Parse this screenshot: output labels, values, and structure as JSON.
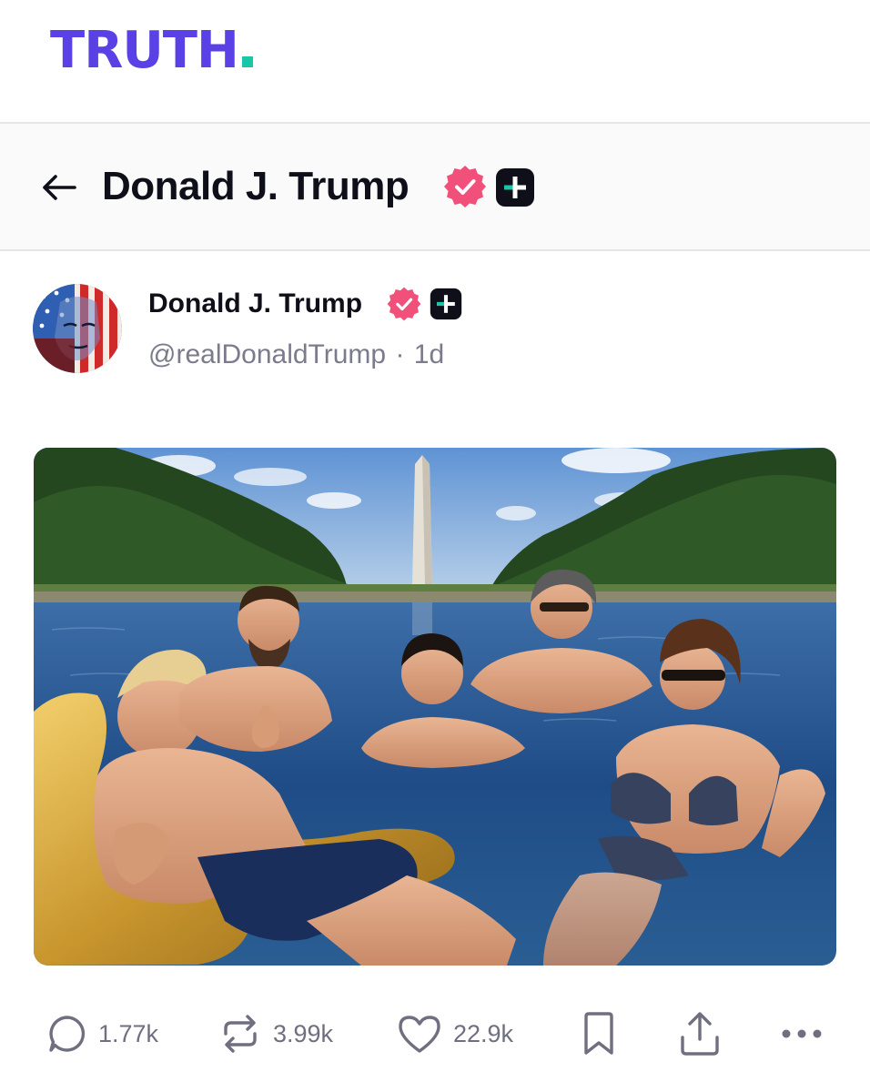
{
  "app": {
    "logo_text": "TRUTH",
    "logo_color": "#5a41e6",
    "logo_dot_color": "#19c6a6"
  },
  "profile_header": {
    "back_icon": "arrow-left-icon",
    "name": "Donald J. Trump",
    "verified_icon": "verified-badge-icon",
    "verified_color": "#f0507a",
    "plus_icon": "truth-plus-icon"
  },
  "post": {
    "author_name": "Donald J. Trump",
    "handle": "@realDonaldTrump",
    "separator": "·",
    "time_ago": "1d",
    "avatar": "avatar-flag-face",
    "image": "ai-generated-reflecting-pool-photo"
  },
  "actions": {
    "reply": {
      "icon": "reply-bubble-icon",
      "count": "1.77k"
    },
    "retruth": {
      "icon": "retruth-icon",
      "count": "3.99k"
    },
    "like": {
      "icon": "heart-icon",
      "count": "22.9k"
    },
    "bookmark": {
      "icon": "bookmark-icon"
    },
    "share": {
      "icon": "share-upload-icon"
    },
    "more": {
      "icon": "more-dots-icon"
    }
  }
}
